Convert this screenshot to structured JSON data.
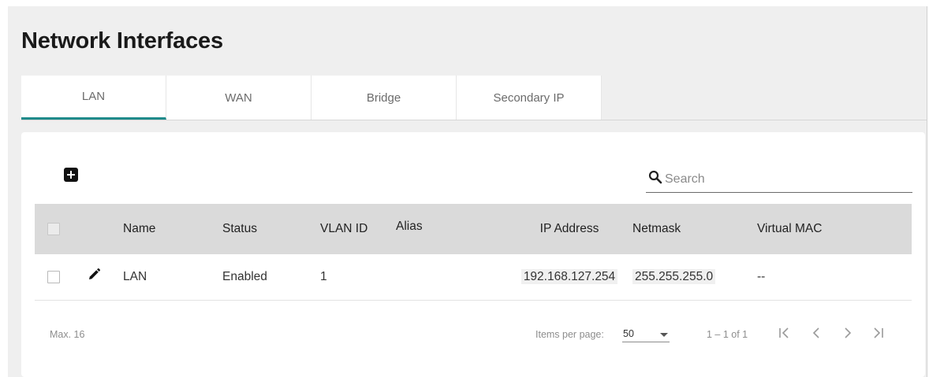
{
  "page": {
    "title": "Network Interfaces"
  },
  "tabs": [
    {
      "label": "LAN",
      "active": true
    },
    {
      "label": "WAN",
      "active": false
    },
    {
      "label": "Bridge",
      "active": false
    },
    {
      "label": "Secondary IP",
      "active": false
    }
  ],
  "toolbar": {
    "add_icon": "plus-box-icon"
  },
  "search": {
    "placeholder": "Search",
    "icon": "search-icon"
  },
  "table": {
    "columns": [
      "Name",
      "Status",
      "VLAN ID",
      "Alias",
      "IP Address",
      "Netmask",
      "Virtual MAC"
    ],
    "rows": [
      {
        "name": "LAN",
        "status": "Enabled",
        "vlan_id": "1",
        "alias": "",
        "ip_address": "192.168.127.254",
        "netmask": "255.255.255.0",
        "virtual_mac": "--"
      }
    ]
  },
  "footer": {
    "max": "Max. 16",
    "items_per_page_label": "Items per page:",
    "items_per_page": "50",
    "range": "1 – 1 of 1"
  },
  "colors": {
    "accent": "#1f8a8a",
    "header_bg": "#dadada",
    "page_bg": "#efefef"
  }
}
